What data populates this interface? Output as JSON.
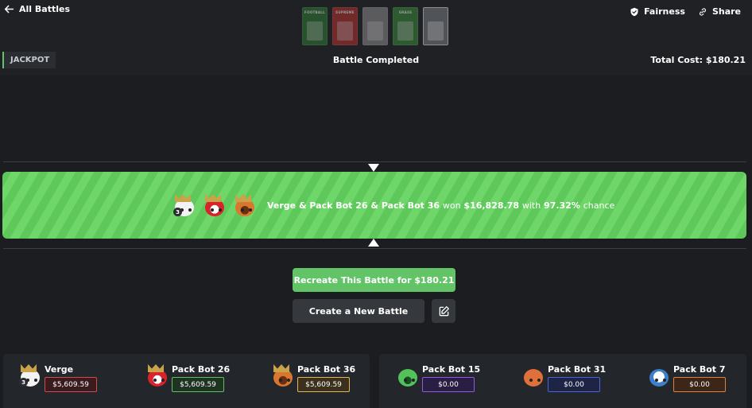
{
  "header": {
    "back_label": "All Battles",
    "fairness_label": "Fairness",
    "share_label": "Share",
    "packs": [
      {
        "title": "FOOTBALL",
        "color": "#2f7a35"
      },
      {
        "title": "SUPREME",
        "color": "#b73130"
      },
      {
        "title": "",
        "color": "#8c8c8c"
      },
      {
        "title": "GRASS",
        "color": "#3c8a3f"
      },
      {
        "title": "",
        "color": "#6b6e73"
      }
    ]
  },
  "battle": {
    "mode": "JACKPOT",
    "status": "Battle Completed",
    "total_cost": "Total Cost: $180.21",
    "result_names": "Verge & Pack Bot 26 & Pack Bot 36",
    "result_won": "won",
    "result_amount": "$16,828.78",
    "result_with": "with",
    "result_chance": "97.32%",
    "result_chance_word": "chance",
    "winner_level": "3"
  },
  "actions": {
    "recreate_label": "Recreate This Battle for $180.21",
    "create_label": "Create a New Battle"
  },
  "teams": [
    {
      "players": [
        {
          "name": "Verge",
          "amount": "$5,609.59",
          "level": "3",
          "color": "#d9474b"
        },
        {
          "name": "Pack Bot 26",
          "amount": "$5,609.59",
          "color": "#5ec35f"
        },
        {
          "name": "Pack Bot 36",
          "amount": "$5,609.59",
          "color": "#e3b45a"
        }
      ]
    },
    {
      "players": [
        {
          "name": "Pack Bot 15",
          "amount": "$0.00",
          "color": "#9a55e6"
        },
        {
          "name": "Pack Bot 31",
          "amount": "$0.00",
          "color": "#4b63d6"
        },
        {
          "name": "Pack Bot 7",
          "amount": "$0.00",
          "color": "#e0803d"
        }
      ]
    }
  ]
}
